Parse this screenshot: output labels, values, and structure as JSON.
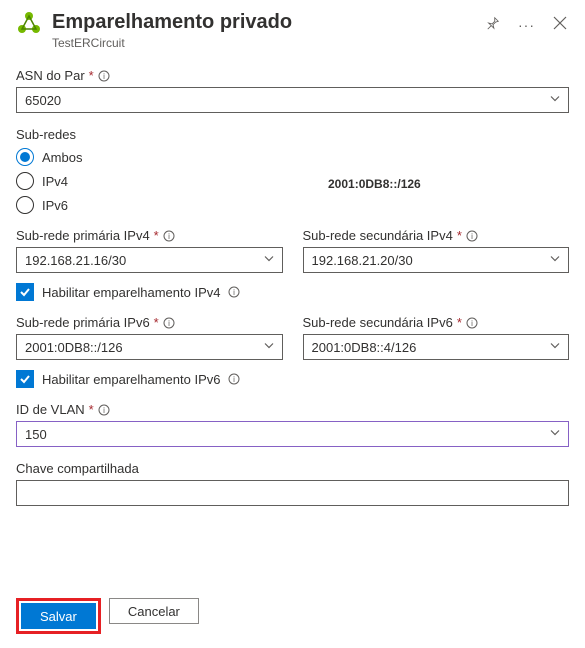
{
  "header": {
    "title": "Emparelhamento privado",
    "subtitle": "TestERCircuit"
  },
  "asn": {
    "label": "ASN do Par",
    "value": "65020"
  },
  "subnets": {
    "label": "Sub-redes",
    "options": {
      "both": "Ambos",
      "ipv4": "IPv4",
      "ipv6": "IPv6"
    },
    "floating": "2001:0DB8::/126"
  },
  "ipv4": {
    "primary_label": "Sub-rede primária IPv4",
    "primary_value": "192.168.21.16/30",
    "secondary_label": "Sub-rede secundária IPv4",
    "secondary_value": "192.168.21.20/30",
    "enable_label": "Habilitar emparelhamento IPv4"
  },
  "ipv6": {
    "primary_label": "Sub-rede primária IPv6",
    "primary_value": "2001:0DB8::/126",
    "secondary_label": "Sub-rede secundária IPv6",
    "secondary_value": "2001:0DB8::4/126",
    "enable_label": "Habilitar emparelhamento IPv6"
  },
  "vlan": {
    "label": "ID de VLAN",
    "value": "150"
  },
  "shared_key": {
    "label": "Chave compartilhada",
    "value": ""
  },
  "buttons": {
    "save": "Salvar",
    "cancel": "Cancelar"
  }
}
